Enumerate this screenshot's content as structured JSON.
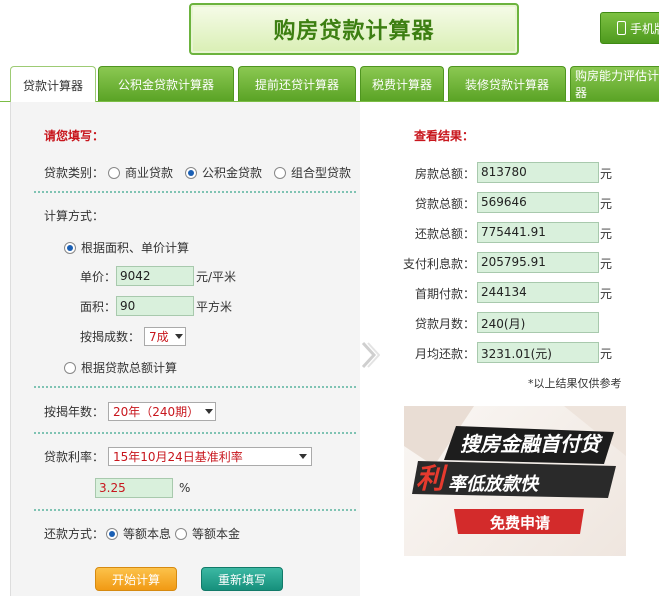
{
  "header": {
    "title": "购房贷款计算器",
    "mobile_label": "手机版"
  },
  "tabs": [
    {
      "label": "贷款计算器",
      "active": true
    },
    {
      "label": "公积金贷款计算器",
      "active": false
    },
    {
      "label": "提前还贷计算器",
      "active": false
    },
    {
      "label": "税费计算器",
      "active": false
    },
    {
      "label": "装修贷款计算器",
      "active": false
    },
    {
      "label": "购房能力评估计算器",
      "active": false
    }
  ],
  "form": {
    "heading": "请您填写：",
    "loan_type_label": "贷款类别：",
    "loan_types": [
      "商业贷款",
      "公积金贷款",
      "组合型贷款"
    ],
    "loan_type_selected": "公积金贷款",
    "calc_method_label": "计算方式：",
    "method_area": "根据面积、单价计算",
    "unit_price_label": "单价：",
    "unit_price_value": "9042",
    "unit_price_unit": "元/平米",
    "area_label": "面积：",
    "area_value": "90",
    "area_unit": "平方米",
    "ratio_label": "按揭成数：",
    "ratio_value": "7成",
    "method_total": "根据贷款总额计算",
    "years_label": "按揭年数：",
    "years_value": "20年（240期）",
    "rate_label": "贷款利率：",
    "rate_value": "15年10月24日基准利率",
    "rate_number": "3.25",
    "rate_unit": "%",
    "repay_label": "还款方式：",
    "repay_options": [
      "等额本息",
      "等额本金"
    ],
    "repay_selected": "等额本息",
    "start_button": "开始计算",
    "reset_button": "重新填写"
  },
  "results": {
    "heading": "查看结果：",
    "rows": [
      {
        "label": "房款总额：",
        "value": "813780",
        "unit": "元"
      },
      {
        "label": "贷款总额：",
        "value": "569646",
        "unit": "元"
      },
      {
        "label": "还款总额：",
        "value": "775441.91",
        "unit": "元"
      },
      {
        "label": "支付利息款：",
        "value": "205795.91",
        "unit": "元"
      },
      {
        "label": "首期付款：",
        "value": "244134",
        "unit": "元"
      },
      {
        "label": "贷款月数：",
        "value": "240(月)",
        "unit": ""
      },
      {
        "label": "月均还款：",
        "value": "3231.01(元)",
        "unit": "元"
      }
    ],
    "note": "*以上结果仅供参考"
  },
  "ad": {
    "line1": "搜房金融首付贷",
    "line2_big": "利",
    "line2_rest": "率低放款快",
    "button": "免费申请"
  },
  "colors": {
    "tab_green": "#5aa325",
    "accent_red": "#c8161d",
    "input_green": "#d9f0dc",
    "button_orange": "#f19a14",
    "button_teal": "#16907c"
  }
}
